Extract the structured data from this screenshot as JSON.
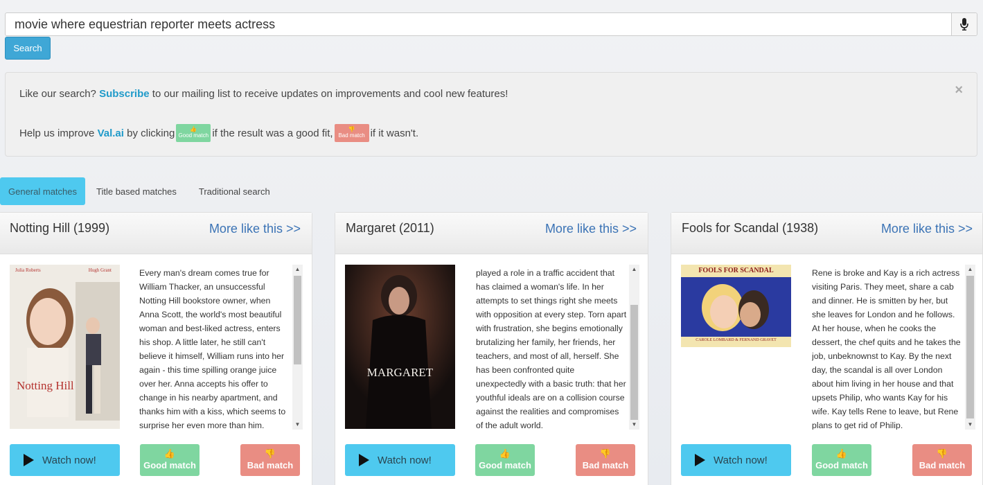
{
  "search": {
    "query": "movie where equestrian reporter meets actress",
    "button_label": "Search"
  },
  "notice": {
    "line1_prefix": "Like our search?",
    "subscribe_label": "Subscribe",
    "line1_suffix": "to our mailing list to receive updates on improvements and cool new features!",
    "line2_prefix": "Help us improve",
    "brand": "Val.ai",
    "line2_mid1": "by clicking",
    "mini_good": "Good match",
    "line2_mid2": "if the result was a good fit,",
    "mini_bad": "Bad match",
    "line2_suffix": "if it wasn't.",
    "close": "×"
  },
  "tabs": [
    {
      "label": "General matches"
    },
    {
      "label": "Title based matches"
    },
    {
      "label": "Traditional search"
    }
  ],
  "cards": [
    {
      "title": "Notting Hill (1999)",
      "more_link": "More like this >>",
      "poster_top": "Julia Roberts",
      "poster_top2": "Hugh Grant",
      "poster_title": "Notting Hill",
      "description": "Every man's dream comes true for William Thacker, an unsuccessful Notting Hill bookstore owner, when Anna Scott, the world's most beautiful woman and best-liked actress, enters his shop. A little later, he still can't believe it himself, William runs into her again - this time spilling orange juice over her. Anna accepts his offer to change in his nearby apartment, and thanks him with a kiss, which seems to surprise her even more than him.",
      "watch_label": "Watch now!",
      "good_label": "Good match",
      "bad_label": "Bad match"
    },
    {
      "title": "Margaret (2011)",
      "more_link": "More like this >>",
      "poster_title": "MARGARET",
      "description": "played a role in a traffic accident that has claimed a woman's life. In her attempts to set things right she meets with opposition at every step. Torn apart with frustration, she begins emotionally brutalizing her family, her friends, her teachers, and most of all, herself. She has been confronted quite unexpectedly with a basic truth: that her youthful ideals are on a collision course against the realities and compromises of the adult world.",
      "watch_label": "Watch now!",
      "good_label": "Good match",
      "bad_label": "Bad match"
    },
    {
      "title": "Fools for Scandal (1938)",
      "more_link": "More like this >>",
      "poster_title": "FOOLS FOR SCANDAL",
      "poster_bottom": "CAROLE LOMBARD & FERNAND GRAVET",
      "description": "Rene is broke and Kay is a rich actress visiting Paris. They meet, share a cab and dinner. He is smitten by her, but she leaves for London and he follows. At her house, when he cooks the dessert, the chef quits and he takes the job, unbeknownst to Kay. By the next day, the scandal is all over London about him living in her house and that upsets Philip, who wants Kay for his wife. Kay tells Rene to leave, but Rene plans to get rid of Philip.",
      "watch_label": "Watch now!",
      "good_label": "Good match",
      "bad_label": "Bad match"
    }
  ],
  "colors": {
    "accent": "#4ec9ef",
    "good": "#7fd6a0",
    "bad": "#e98d83",
    "link": "#3b73b5"
  }
}
